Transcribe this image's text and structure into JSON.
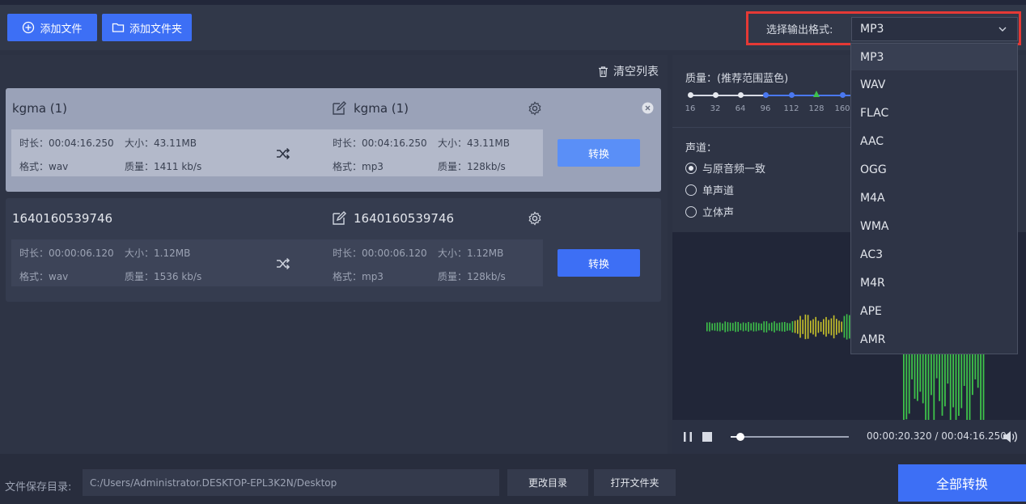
{
  "toolbar": {
    "add_file_label": "添加文件",
    "add_folder_label": "添加文件夹"
  },
  "output_format": {
    "label": "选择输出格式:",
    "selected": "MP3",
    "options": [
      "MP3",
      "WAV",
      "FLAC",
      "AAC",
      "OGG",
      "M4A",
      "WMA",
      "AC3",
      "M4R",
      "APE",
      "AMR"
    ]
  },
  "file_list": {
    "clear_label": "清空列表",
    "items": [
      {
        "name": "kgma (1)",
        "output_name": "kgma (1)",
        "source": {
          "duration": "时长：00:04:16.250",
          "size": "大小：43.11MB",
          "format": "格式：wav",
          "quality": "质量：1411 kb/s"
        },
        "target": {
          "duration": "时长：00:04:16.250",
          "size": "大小：43.11MB",
          "format": "格式：mp3",
          "quality": "质量：128kb/s"
        },
        "convert_label": "转换"
      },
      {
        "name": "1640160539746",
        "output_name": "1640160539746",
        "source": {
          "duration": "时长：00:00:06.120",
          "size": "大小：1.12MB",
          "format": "格式：wav",
          "quality": "质量：1536 kb/s"
        },
        "target": {
          "duration": "时长：00:00:06.120",
          "size": "大小：1.12MB",
          "format": "格式：mp3",
          "quality": "质量：128kb/s"
        },
        "convert_label": "转换"
      }
    ]
  },
  "settings": {
    "quality_title": "质量：(推荐范围蓝色)",
    "quality_ticks": [
      "16",
      "32",
      "64",
      "96",
      "112",
      "128",
      "160"
    ],
    "channel_title": "声道：",
    "channels": [
      "与原音频一致",
      "单声道",
      "立体声"
    ],
    "channel_selected_index": 0
  },
  "player": {
    "time": "00:00:20.320 / 00:04:16.250",
    "progress": 0.08
  },
  "bottom": {
    "save_label": "文件保存目录:",
    "save_path": "C:/Users/Administrator.DESKTOP-EPL3K2N/Desktop",
    "change_dir_label": "更改目录",
    "open_folder_label": "打开文件夹",
    "convert_all_label": "全部转换"
  },
  "colors": {
    "accent": "#3d6ff5",
    "highlight_border": "#e53935",
    "wave_green": "#3ec24a",
    "wave_yellow": "#c9c42a"
  }
}
